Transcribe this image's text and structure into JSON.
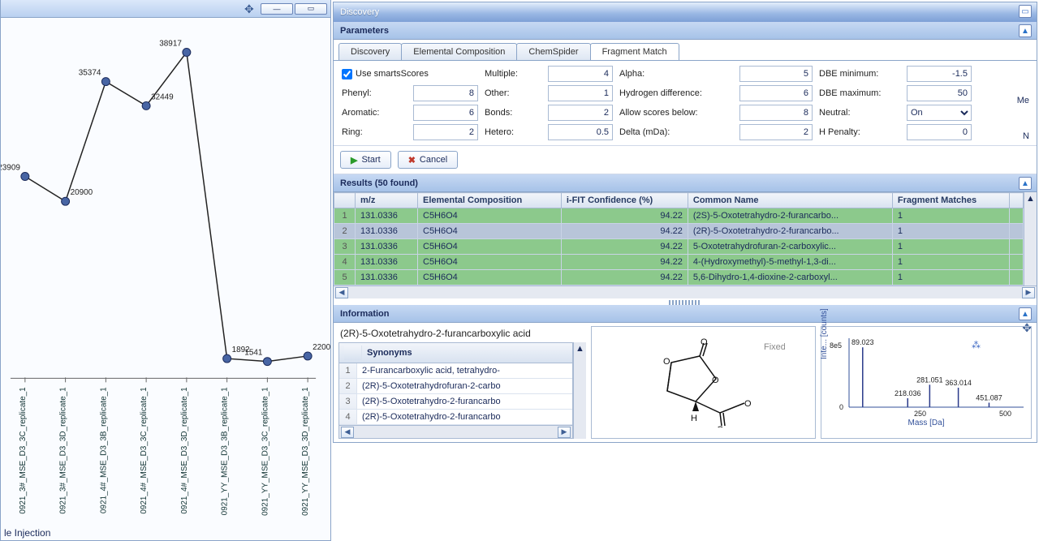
{
  "left_panel": {
    "bottom_note": "le Injection"
  },
  "discovery": {
    "title": "Discovery",
    "parameters_title": "Parameters",
    "tabs": [
      "Discovery",
      "Elemental Composition",
      "ChemSpider",
      "Fragment Match"
    ],
    "active_tab": 3,
    "use_smarts_label": "Use smartsScores",
    "fields": {
      "multiple_label": "Multiple:",
      "multiple": "4",
      "alpha_label": "Alpha:",
      "alpha": "5",
      "dbemin_label": "DBE minimum:",
      "dbemin": "-1.5",
      "phenyl_label": "Phenyl:",
      "phenyl": "8",
      "other_label": "Other:",
      "other": "1",
      "hdiff_label": "Hydrogen difference:",
      "hdiff": "6",
      "dbemax_label": "DBE maximum:",
      "dbemax": "50",
      "aromatic_label": "Aromatic:",
      "aromatic": "6",
      "bonds_label": "Bonds:",
      "bonds": "2",
      "allow_label": "Allow scores below:",
      "allow": "8",
      "neutral_label": "Neutral:",
      "neutral": "On",
      "ring_label": "Ring:",
      "ring": "2",
      "hetero_label": "Hetero:",
      "hetero": "0.5",
      "delta_label": "Delta (mDa):",
      "delta": "2",
      "hpen_label": "H Penalty:",
      "hpen": "0",
      "me_label": "Me",
      "n_label": "N"
    },
    "start_label": "Start",
    "cancel_label": "Cancel"
  },
  "results": {
    "title": "Results (50 found)",
    "columns": [
      "",
      "m/z",
      "Elemental Composition",
      "i-FIT Confidence (%)",
      "Common Name",
      "Fragment Matches",
      ""
    ],
    "rows": [
      {
        "n": "1",
        "mz": "131.0336",
        "ec": "C5H6O4",
        "ifit": "94.22",
        "name": "(2S)-5-Oxotetrahydro-2-furancarbo...",
        "fm": "1",
        "sel": false
      },
      {
        "n": "2",
        "mz": "131.0336",
        "ec": "C5H6O4",
        "ifit": "94.22",
        "name": "(2R)-5-Oxotetrahydro-2-furancarbo...",
        "fm": "1",
        "sel": true
      },
      {
        "n": "3",
        "mz": "131.0336",
        "ec": "C5H6O4",
        "ifit": "94.22",
        "name": "5-Oxotetrahydrofuran-2-carboxylic...",
        "fm": "1",
        "sel": false
      },
      {
        "n": "4",
        "mz": "131.0336",
        "ec": "C5H6O4",
        "ifit": "94.22",
        "name": "4-(Hydroxymethyl)-5-methyl-1,3-di...",
        "fm": "1",
        "sel": false
      },
      {
        "n": "5",
        "mz": "131.0336",
        "ec": "C5H6O4",
        "ifit": "94.22",
        "name": "5,6-Dihydro-1,4-dioxine-2-carboxyl...",
        "fm": "1",
        "sel": false
      }
    ]
  },
  "info": {
    "title": "Information",
    "compound_name": "(2R)-5-Oxotetrahydro-2-furancarboxylic acid",
    "syn_header": "Synonyms",
    "synonyms": [
      "2-Furancarboxylic acid, tetrahydro-",
      "(2R)-5-Oxotetrahydrofuran-2-carbo",
      "(2R)-5-Oxotetrahydro-2-furancarbo",
      "(2R)-5-Oxotetrahydro-2-furancarbo"
    ],
    "spectrum": {
      "ylab": "Inte... [counts]",
      "xlab": "Mass [Da]",
      "ytick": "8e5",
      "ytick0": "0",
      "xticks": [
        "250",
        "500"
      ]
    }
  },
  "chart_data": {
    "type": "line",
    "title": "",
    "xlabel": "",
    "ylabel": "",
    "categories": [
      "0921_3#_MSE_D3_3C_replicate_1",
      "0921_3#_MSE_D3_3D_replicate_1",
      "0921_4#_MSE_D3_3B_replicate_1",
      "0921_4#_MSE_D3_3C_replicate_1",
      "0921_4#_MSE_D3_3D_replicate_1",
      "0921_YY_MSE_D3_3B_replicate_1",
      "0921_YY_MSE_D3_3C_replicate_1",
      "0921_YY_MSE_D3_3D_replicate_1"
    ],
    "values": [
      23909,
      20900,
      35374,
      32449,
      38917,
      1892,
      1541,
      2200
    ],
    "ylim": [
      0,
      40000
    ]
  },
  "spectrum_data": {
    "type": "bar",
    "peaks": [
      {
        "mass": 89.023,
        "intensity": 800000
      },
      {
        "mass": 218.036,
        "intensity": 120000
      },
      {
        "mass": 281.051,
        "intensity": 300000
      },
      {
        "mass": 363.014,
        "intensity": 260000
      },
      {
        "mass": 451.087,
        "intensity": 60000
      }
    ],
    "xlim": [
      50,
      550
    ],
    "ylim": [
      0,
      900000
    ]
  }
}
